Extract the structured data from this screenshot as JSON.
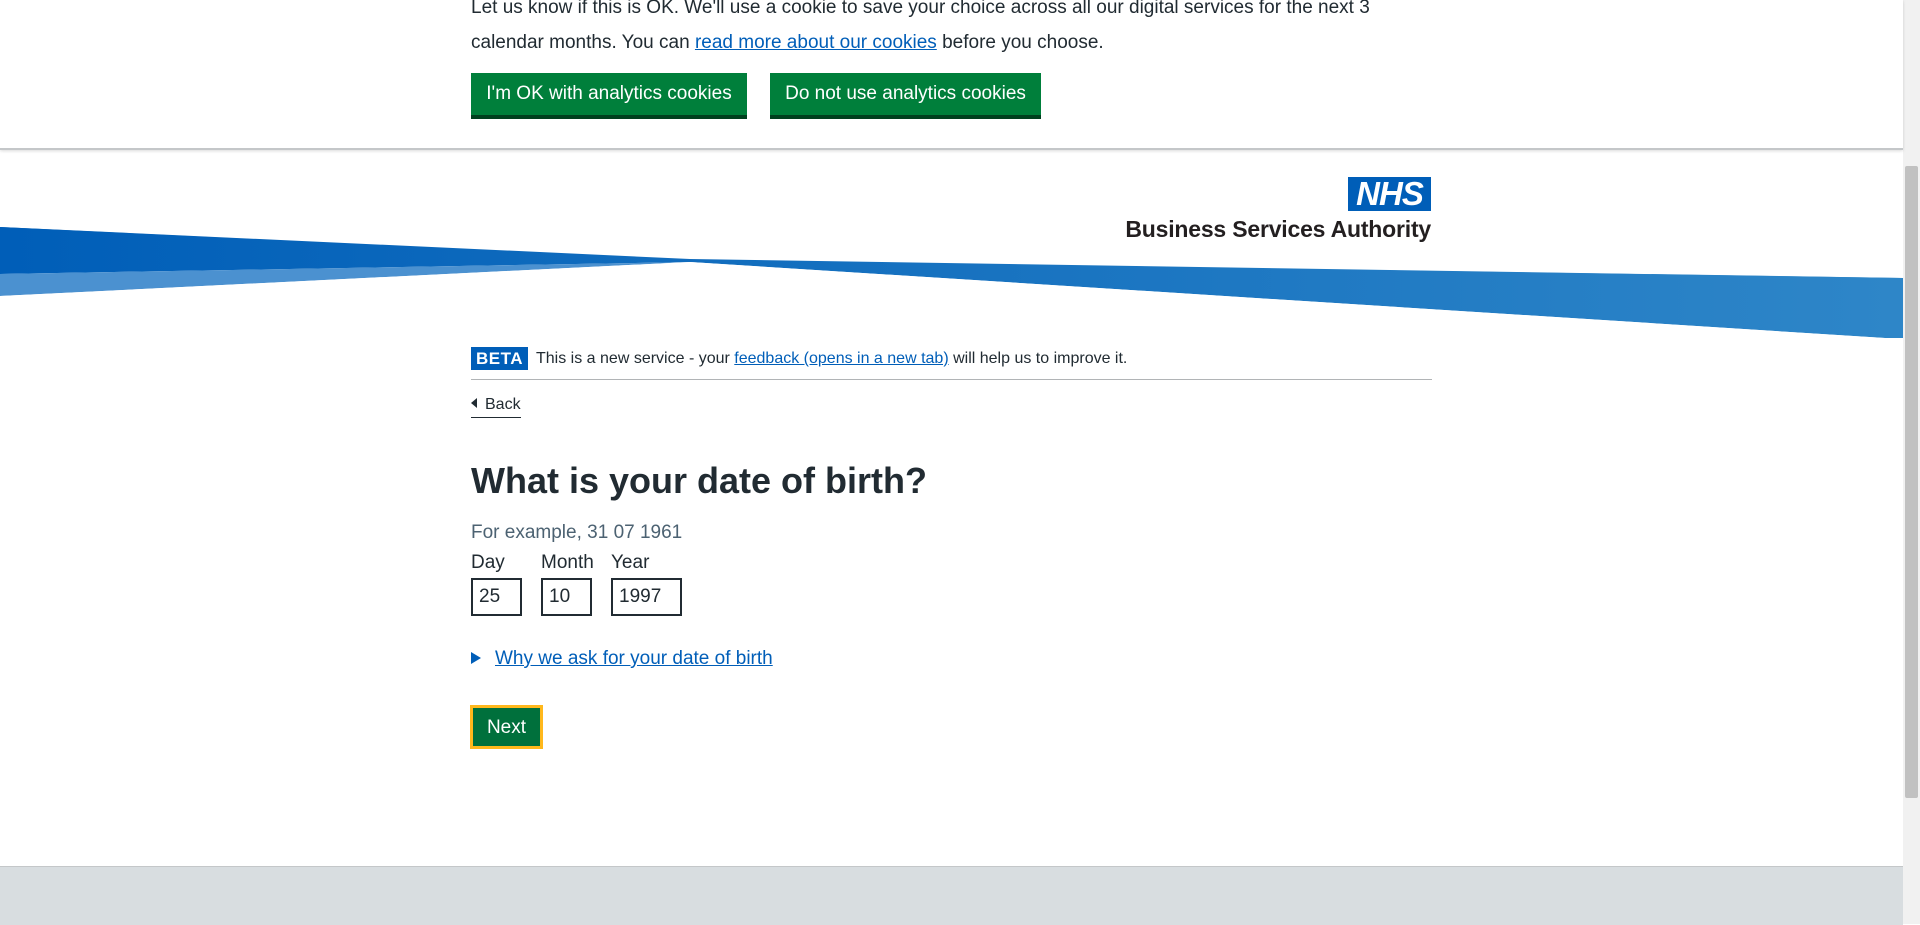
{
  "cookie_banner": {
    "text_before_link": "Let us know if this is OK. We'll use a cookie to save your choice across all our digital services for the next 3 calendar months. You can ",
    "link_text": "read more about our cookies",
    "text_after_link": " before you choose.",
    "accept_label": "I'm OK with analytics cookies",
    "reject_label": "Do not use analytics cookies"
  },
  "header": {
    "logo_mark": "NHS",
    "logo_text": "Business Services Authority"
  },
  "beta_banner": {
    "tag": "BETA",
    "text_before_link": "This is a new service - your ",
    "link_text": "feedback (opens in a new tab)",
    "text_after_link": " will help us to improve it."
  },
  "back_link": "Back",
  "question": {
    "title": "What is your date of birth?",
    "hint": "For example, 31 07 1961",
    "day_label": "Day",
    "month_label": "Month",
    "year_label": "Year",
    "day_value": "25",
    "month_value": "10",
    "year_value": "1997"
  },
  "details_summary": "Why we ask for your date of birth",
  "next_button": "Next",
  "colors": {
    "nhs_blue": "#005eb8",
    "button_green": "#007f3b",
    "focus_yellow": "#ffb81c"
  }
}
